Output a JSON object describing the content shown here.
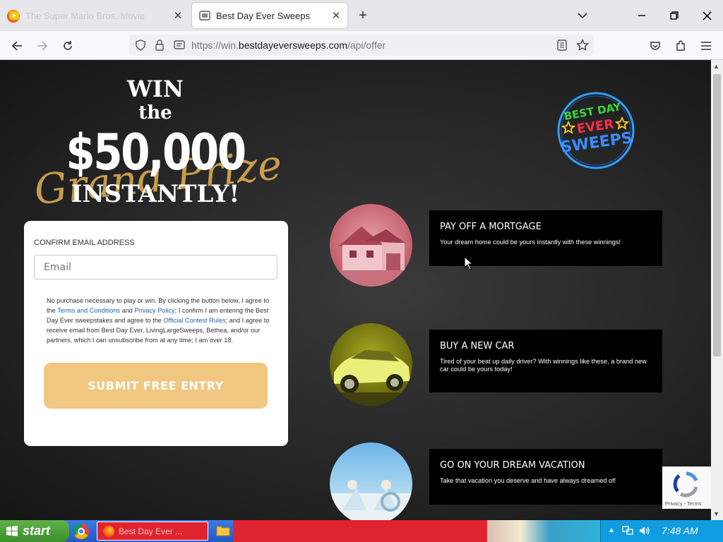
{
  "browser": {
    "tabs": [
      {
        "title": "The Super Mario Bros. Movie",
        "active": false
      },
      {
        "title": "Best Day Ever Sweeps",
        "active": true
      }
    ],
    "url": {
      "prefix": "https://win.",
      "domain": "bestdayeversweeps.com",
      "path": "/api/offer"
    }
  },
  "hero": {
    "win": "WIN",
    "the": "the",
    "amount": "$50,000",
    "script": "Grand Prize",
    "instantly": "INSTANTLY!"
  },
  "logo": {
    "line1": "BEST DAY",
    "line2": "EVER",
    "line3": "SWEEPS"
  },
  "form": {
    "label": "CONFIRM EMAIL ADDRESS",
    "email_placeholder": "Email",
    "legal": {
      "p1": "No purchase necessary to play or win. By clicking the button below, I agree to the ",
      "link1": "Terms and Conditions",
      "p2": " and ",
      "link2": "Privacy Policy",
      "p3": "; I confirm I am entering the Best Day Ever sweepstakes and agree to the ",
      "link3": "Official Contest Rules",
      "p4": "; and I agree to receive email from Best Day Ever, LivingLargeSweeps, Bethea, and/or our partners, which I can unsubscribe from at any time; I am over 18."
    },
    "submit": "SUBMIT FREE ENTRY"
  },
  "features": [
    {
      "title": "PAY OFF A MORTGAGE",
      "desc": "Your dream home could be yours instantly with these winnings!"
    },
    {
      "title": "BUY A NEW CAR",
      "desc": "Tired of your beat up daily driver? With winnings like these, a brand new car could be yours today!"
    },
    {
      "title": "GO ON YOUR DREAM VACATION",
      "desc": "Take that vacation you deserve and have always dreamed of!"
    }
  ],
  "recaptcha": {
    "privacy": "Privacy",
    "terms": "Terms",
    "sep": " - "
  },
  "taskbar": {
    "start": "start",
    "ff_label": "Best Day Ever ...",
    "clock": "7:48 AM"
  },
  "colors": {
    "submit": "#f0c780",
    "card": "#ffffff",
    "feature_box": "#000000",
    "taskbar": "#2458c6"
  }
}
